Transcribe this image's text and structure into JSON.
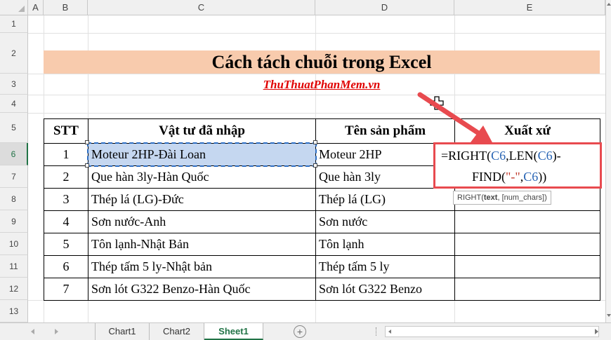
{
  "columns": [
    "A",
    "B",
    "C",
    "D",
    "E"
  ],
  "rows": [
    "1",
    "2",
    "3",
    "4",
    "5",
    "6",
    "7",
    "8",
    "9",
    "10",
    "11",
    "12",
    "13"
  ],
  "title": "Cách tách chuỗi trong Excel",
  "watermark": "ThuThuatPhanMem.vn",
  "table": {
    "headers": [
      "STT",
      "Vật tư đã nhập",
      "Tên sản phẩm",
      "Xuất xứ"
    ],
    "rows": [
      [
        "1",
        "Moteur 2HP-Đài Loan",
        "Moteur 2HP"
      ],
      [
        "2",
        "Que hàn 3ly-Hàn Quốc",
        "Que hàn 3ly"
      ],
      [
        "3",
        "Thép lá (LG)-Đức",
        "Thép lá (LG)"
      ],
      [
        "4",
        "Sơn nước-Anh",
        "Sơn nước"
      ],
      [
        "5",
        "Tôn lạnh-Nhật Bản",
        "Tôn lạnh"
      ],
      [
        "6",
        "Thép tấm 5 ly-Nhật bản",
        "Thép tấm 5 ly"
      ],
      [
        "7",
        "Sơn lót G322 Benzo-Hàn Quốc",
        "Sơn lót G322 Benzo"
      ]
    ]
  },
  "formula": {
    "p1": "=RIGHT(",
    "ref1": "C6",
    "p2": ",LEN(",
    "ref2": "C6",
    "p3": ")-",
    "p4": "FIND(",
    "str": "\"-\"",
    "p5": ",",
    "ref3": "C6",
    "p6": "))"
  },
  "tooltip": {
    "prefix": "RIGHT(",
    "bold": "text",
    "suffix": ", [num_chars])"
  },
  "sheets": {
    "tabs": [
      "Chart1",
      "Chart2",
      "Sheet1"
    ],
    "active": "Sheet1",
    "add": "+"
  },
  "colors": {
    "accent": "#217346",
    "title_bg": "#f8cbad",
    "arrow": "#e84a4f",
    "link": "#e00000"
  }
}
